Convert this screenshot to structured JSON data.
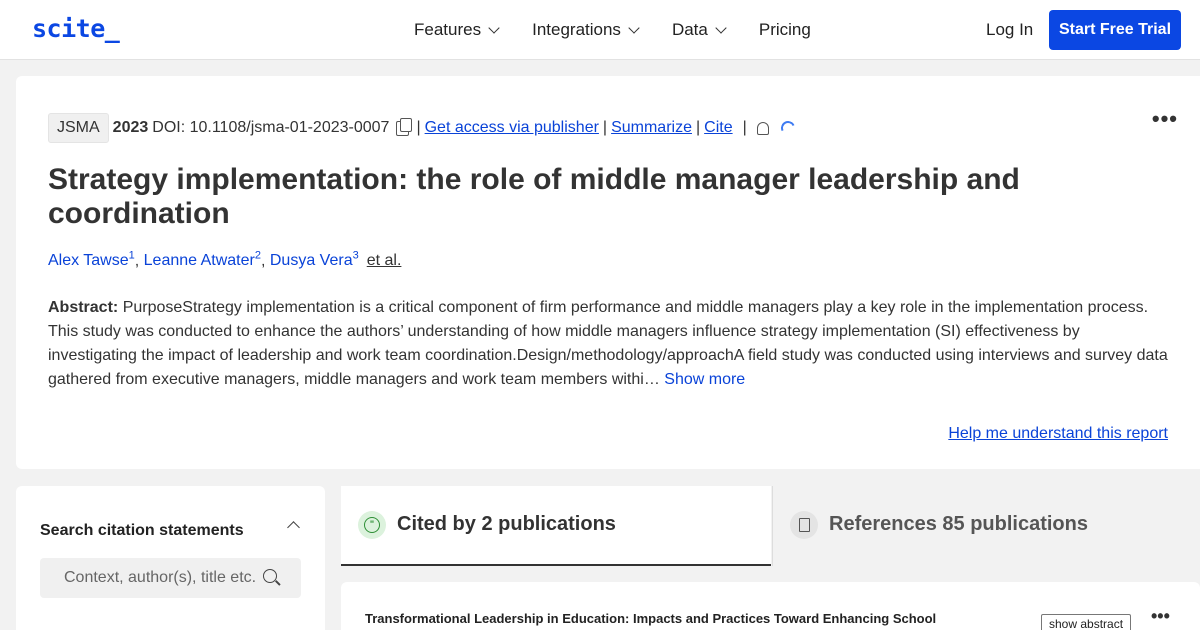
{
  "header": {
    "logo": "scite_",
    "nav": [
      "Features",
      "Integrations",
      "Data",
      "Pricing"
    ],
    "login": "Log In",
    "cta": "Start Free Trial"
  },
  "paper": {
    "journal": "JSMA",
    "year": "2023",
    "doi": "DOI: 10.1108/jsma-01-2023-0007",
    "links": [
      "Get access via publisher",
      "Summarize",
      "Cite"
    ],
    "title": "Strategy implementation: the role of middle manager leadership and coordination",
    "authors": [
      {
        "name": "Alex Tawse",
        "sup": "1"
      },
      {
        "name": "Leanne Atwater",
        "sup": "2"
      },
      {
        "name": "Dusya Vera",
        "sup": "3"
      }
    ],
    "etal": "et al.",
    "abstract_label": "Abstract:",
    "abstract_text": "PurposeStrategy implementation is a critical component of firm performance and middle managers play a key role in the implementation process. This study was conducted to enhance the authors’ understanding of how middle managers influence strategy implementation (SI) effectiveness by investigating the impact of leadership and work team coordination.Design/methodology/approachA field study was conducted using interviews and survey data gathered from executive managers, middle managers and work team members withi…",
    "show_more": "Show more",
    "help": "Help me understand this report"
  },
  "sidebar": {
    "title": "Search citation statements",
    "search_placeholder": "Context, author(s), title etc."
  },
  "tabs": [
    {
      "label": "Cited by 2 publications"
    },
    {
      "label": "References 85 publications"
    }
  ],
  "result": {
    "title": "Transformational Leadership in Education: Impacts and Practices Toward Enhancing School",
    "show_abstract": "show abstract"
  }
}
